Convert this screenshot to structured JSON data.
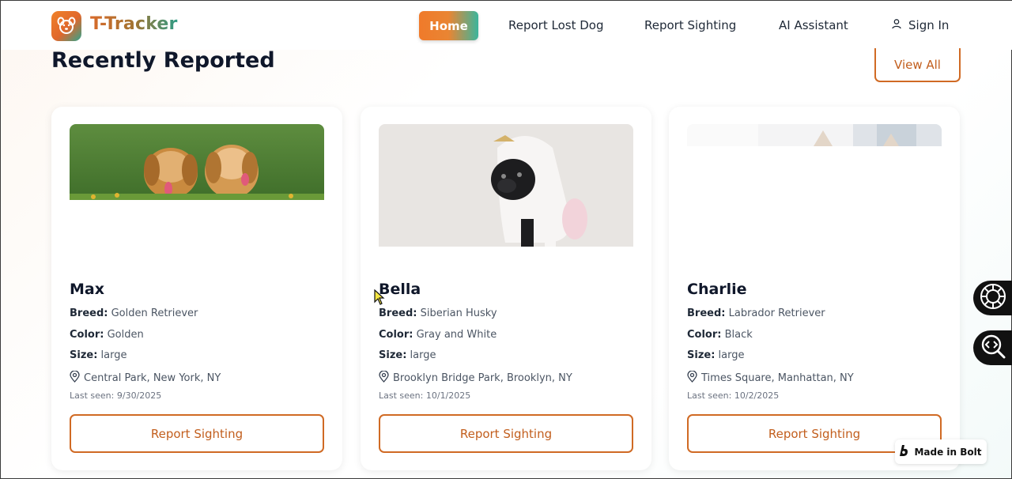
{
  "header": {
    "brand": "T-Tracker",
    "nav": {
      "home": "Home",
      "report_lost": "Report Lost Dog",
      "report_sighting": "Report Sighting",
      "ai_assistant": "AI Assistant",
      "sign_in": "Sign In"
    }
  },
  "section": {
    "title": "Recently Reported",
    "view_all": "View All"
  },
  "labels": {
    "breed": "Breed:",
    "color": "Color:",
    "size": "Size:",
    "last_seen": "Last seen:",
    "report_button": "Report Sighting"
  },
  "dogs": [
    {
      "name": "Max",
      "breed": "Golden Retriever",
      "color": "Golden",
      "size": "large",
      "location": "Central Park, New York, NY",
      "last_seen": "9/30/2025"
    },
    {
      "name": "Bella",
      "breed": "Siberian Husky",
      "color": "Gray and White",
      "size": "large",
      "location": "Brooklyn Bridge Park, Brooklyn, NY",
      "last_seen": "10/1/2025"
    },
    {
      "name": "Charlie",
      "breed": "Labrador Retriever",
      "color": "Black",
      "size": "large",
      "location": "Times Square, Manhattan, NY",
      "last_seen": "10/2/2025"
    }
  ],
  "badge": {
    "text": "Made in Bolt"
  },
  "colors": {
    "accent_orange": "#d06a24",
    "accent_teal": "#2e9c86"
  }
}
